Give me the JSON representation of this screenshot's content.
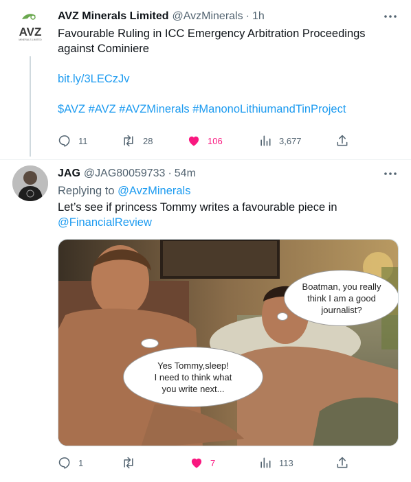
{
  "tweets": [
    {
      "author": {
        "name": "AVZ Minerals Limited",
        "handle": "@AvzMinerals",
        "time": "1h"
      },
      "logo": {
        "text": "AVZ",
        "subtext": "MINERALS LIMITED",
        "color": "#6aa84f"
      },
      "text_lines": [
        "Favourable Ruling in ICC Emergency Arbitration Proceedings",
        "against Cominiere"
      ],
      "link": "bit.ly/3LECzJv",
      "hashtags": "$AVZ #AVZ #AVZMinerals #ManonoLithiumandTinProject",
      "stats": {
        "replies": "11",
        "retweets": "28",
        "likes": "106",
        "views": "3,677"
      }
    },
    {
      "author": {
        "name": "JAG",
        "handle": "@JAG80059733",
        "time": "54m"
      },
      "replying_prefix": "Replying to",
      "replying_to": "@AvzMinerals",
      "text": "Let’s see if princess Tommy writes a favourable piece in",
      "mention": "@FinancialReview",
      "image": {
        "bubble_right": [
          "Boatman, you really",
          "think I am a good",
          "journalist?"
        ],
        "bubble_left": [
          "Yes Tommy,sleep!",
          "I need to think what",
          "you write next..."
        ]
      },
      "stats": {
        "replies": "1",
        "retweets": "",
        "likes": "7",
        "views": "113"
      }
    }
  ],
  "colors": {
    "accent": "#1d9bf0",
    "like": "#f91880",
    "muted": "#536471"
  },
  "icons": [
    "more-icon",
    "reply-icon",
    "retweet-icon",
    "heart-icon",
    "views-icon",
    "share-icon"
  ]
}
